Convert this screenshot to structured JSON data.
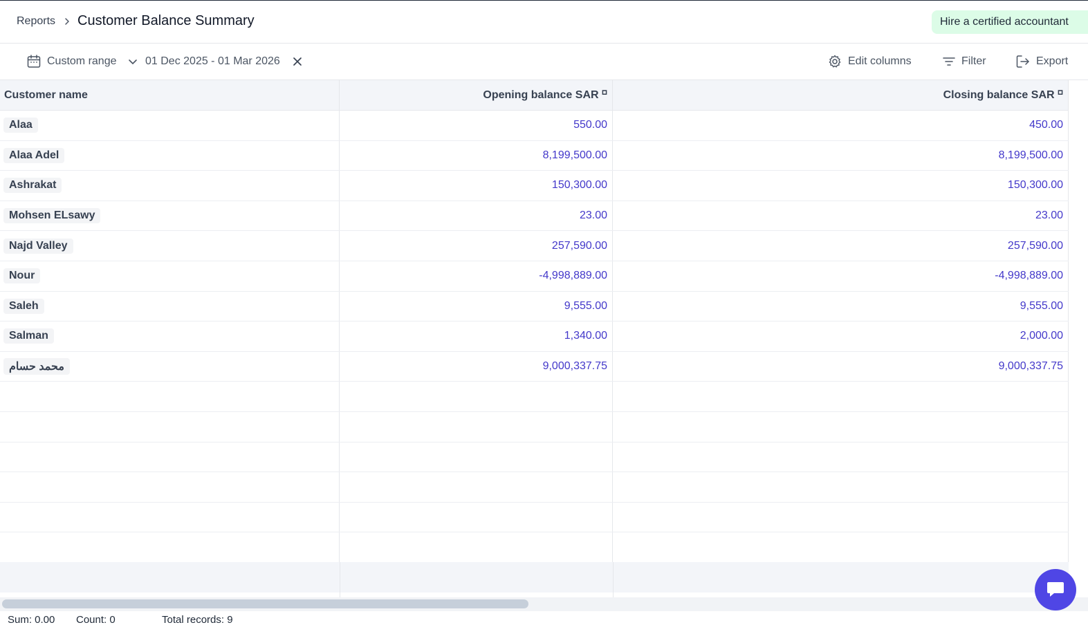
{
  "breadcrumb": {
    "root": "Reports",
    "title": "Customer Balance Summary"
  },
  "header": {
    "hire_label": "Hire a certified accountant"
  },
  "toolbar": {
    "range_label": "Custom range",
    "date_range": "01 Dec 2025 - 01 Mar 2026",
    "edit_columns": "Edit columns",
    "filter": "Filter",
    "export": "Export"
  },
  "table": {
    "columns": {
      "name": "Customer name",
      "opening": "Opening balance  SAR ⸋",
      "closing": "Closing balance  SAR ⸋"
    },
    "rows": [
      {
        "name": "Alaa",
        "opening": "550.00",
        "closing": "450.00"
      },
      {
        "name": "Alaa Adel",
        "opening": "8,199,500.00",
        "closing": "8,199,500.00"
      },
      {
        "name": "Ashrakat",
        "opening": "150,300.00",
        "closing": "150,300.00"
      },
      {
        "name": "Mohsen ELsawy",
        "opening": "23.00",
        "closing": "23.00"
      },
      {
        "name": "Najd Valley",
        "opening": "257,590.00",
        "closing": "257,590.00"
      },
      {
        "name": "Nour",
        "opening": "-4,998,889.00",
        "closing": "-4,998,889.00"
      },
      {
        "name": "Saleh",
        "opening": "9,555.00",
        "closing": "9,555.00"
      },
      {
        "name": "Salman",
        "opening": "1,340.00",
        "closing": "2,000.00"
      },
      {
        "name": "محمد حسام",
        "opening": "9,000,337.75",
        "closing": "9,000,337.75"
      }
    ]
  },
  "status": {
    "sum": "Sum: 0.00",
    "count": "Count: 0",
    "total": "Total records: 9"
  },
  "colors": {
    "accent": "#4f46e5",
    "value": "#4338ca",
    "hire_bg": "#dcfce7",
    "header_bg": "#f3f5f9"
  }
}
